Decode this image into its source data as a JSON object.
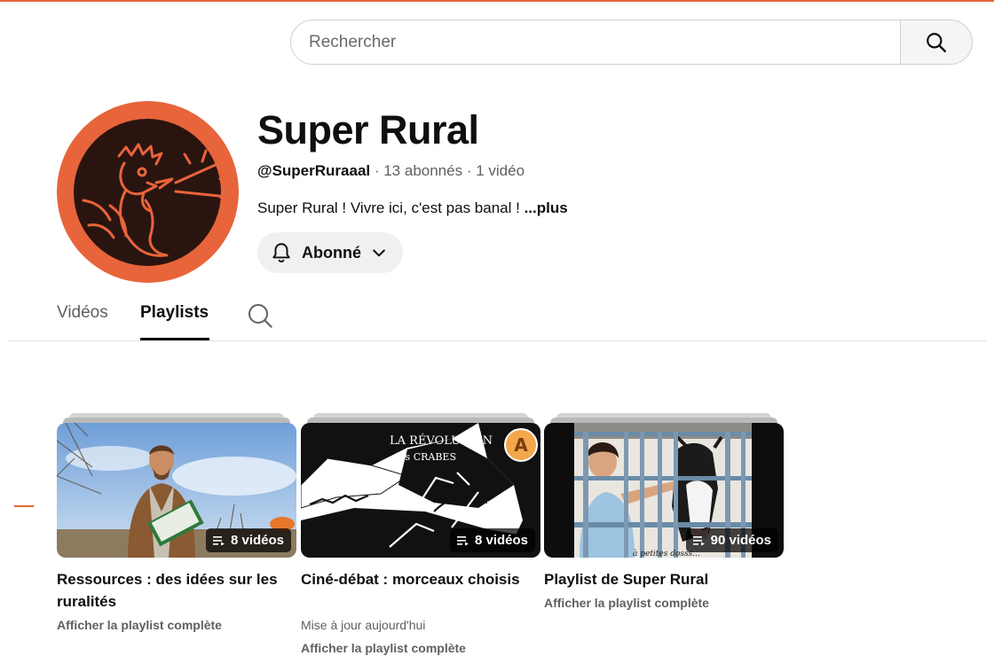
{
  "search": {
    "placeholder": "Rechercher",
    "icon": "search-icon"
  },
  "channel": {
    "name": "Super Rural",
    "handle": "@SuperRuraaal",
    "stats": " · 13 abonnés · 1 vidéo",
    "description": "Super Rural ! Vivre ici, c'est pas banal ! ",
    "more_label": "...plus",
    "avatar_bg": "#e8643a"
  },
  "subscribe": {
    "label": "Abonné",
    "bell_icon": "bell-icon",
    "chevron_icon": "chevron-down-icon"
  },
  "tabs": [
    {
      "label": "Vidéos",
      "active": false
    },
    {
      "label": "Playlists",
      "active": true
    }
  ],
  "playlists": [
    {
      "title": "Ressources : des idées sur les ruralités",
      "count": "8 vidéos",
      "updated": "",
      "link": "Afficher la playlist complète"
    },
    {
      "title": "Ciné-débat : morceaux choisis",
      "count": "8 vidéos",
      "updated": "Mise à jour aujourd'hui",
      "link": "Afficher la playlist complète",
      "thumb_text_line1": "LA RÉVOLUTION",
      "thumb_text_line2": "des CRABES",
      "thumb_badge": "A"
    },
    {
      "title": "Playlist de Super Rural",
      "count": "90 vidéos",
      "updated": "",
      "link": "Afficher la playlist complète",
      "thumb_caption": "à petites dosss..."
    }
  ],
  "colors": {
    "accent": "#e8643a",
    "text": "#0f0f0f",
    "muted": "#606060"
  }
}
